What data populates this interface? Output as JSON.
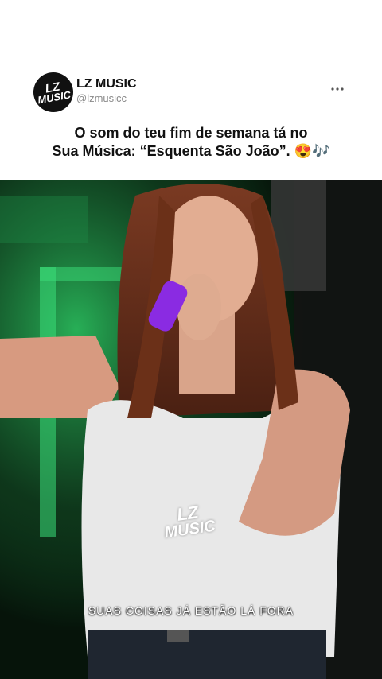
{
  "post": {
    "account_name": "LZ MUSIC",
    "handle": "@lzmusicc",
    "avatar_text_line1": "LZ",
    "avatar_text_line2": "MUSIC",
    "caption_line1": "O som do teu fim de semana tá no",
    "caption_line2": "Sua Música: “Esquenta São João”. 😍🎶",
    "more_icon": "more-horizontal-icon"
  },
  "video": {
    "watermark_line1": "LZ",
    "watermark_line2": "MUSIC",
    "subtitle": "SUAS COISAS JÁ ESTÃO LÁ FORA"
  },
  "colors": {
    "background": "#ffffff",
    "text": "#111111",
    "handle": "#8a8a8a",
    "stage_green": "#2fd36a",
    "microphone": "#8a2be2"
  }
}
